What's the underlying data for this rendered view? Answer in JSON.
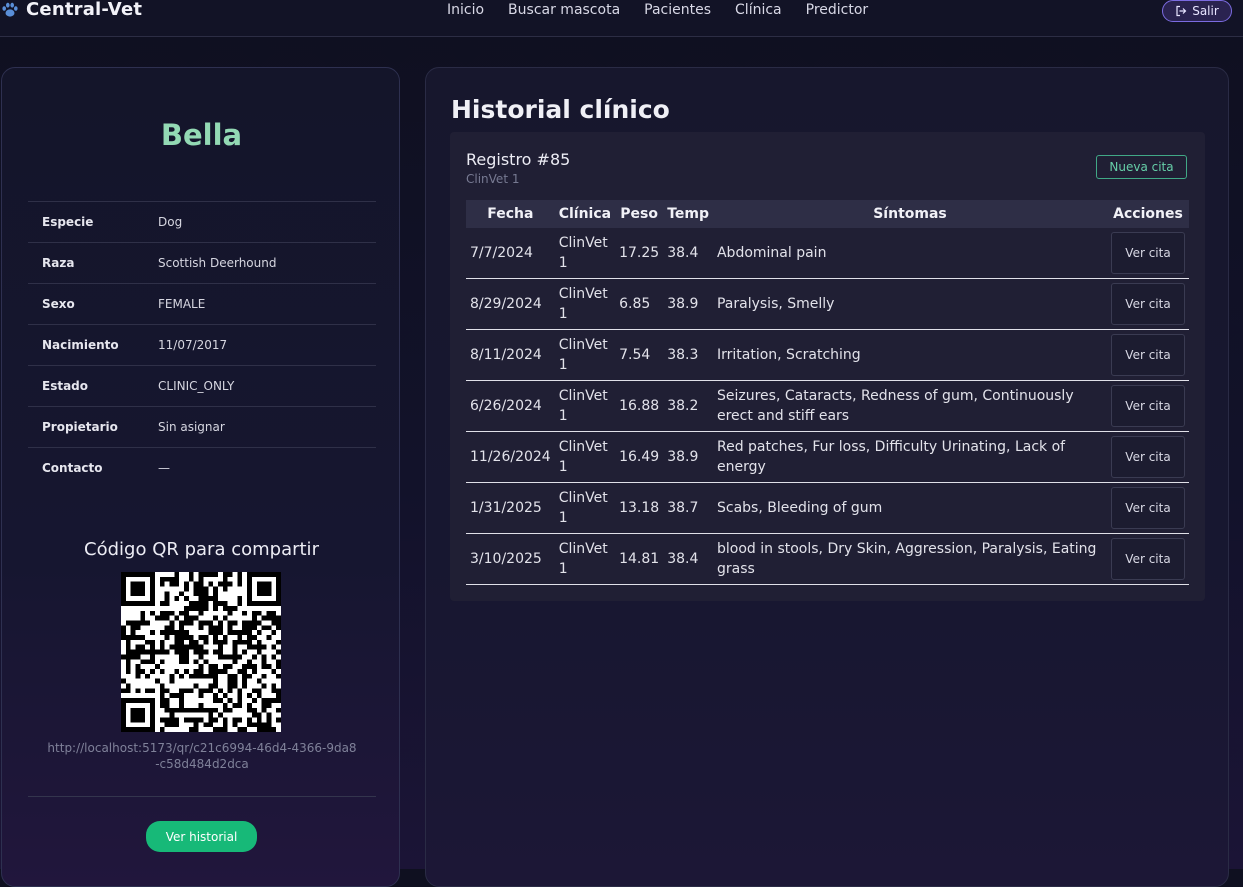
{
  "nav": {
    "brand": "Central-Vet",
    "links": [
      "Inicio",
      "Buscar mascota",
      "Pacientes",
      "Clínica",
      "Predictor"
    ],
    "logout_label": "Salir"
  },
  "pet": {
    "name": "Bella",
    "info": [
      {
        "label": "Especie",
        "value": "Dog"
      },
      {
        "label": "Raza",
        "value": "Scottish Deerhound"
      },
      {
        "label": "Sexo",
        "value": "FEMALE"
      },
      {
        "label": "Nacimiento",
        "value": "11/07/2017"
      },
      {
        "label": "Estado",
        "value": "CLINIC_ONLY"
      },
      {
        "label": "Propietario",
        "value": "Sin asignar"
      },
      {
        "label": "Contacto",
        "value": "—"
      }
    ],
    "qr_title": "Código QR para compartir",
    "qr_url": "http://localhost:5173/qr/c21c6994-46d4-4366-9da8-c58d484d2dca",
    "history_button": "Ver historial"
  },
  "history": {
    "title": "Historial clínico",
    "record_title": "Registro #85",
    "record_subtitle": "ClinVet 1",
    "new_button": "Nueva cita",
    "columns": [
      "Fecha",
      "Clínica",
      "Peso",
      "Temp",
      "Síntomas",
      "Acciones"
    ],
    "action_label": "Ver cita",
    "rows": [
      {
        "fecha": "7/7/2024",
        "clinica": "ClinVet 1",
        "peso": "17.25",
        "temp": "38.4",
        "sintomas": "Abdominal pain"
      },
      {
        "fecha": "8/29/2024",
        "clinica": "ClinVet 1",
        "peso": "6.85",
        "temp": "38.9",
        "sintomas": "Paralysis, Smelly"
      },
      {
        "fecha": "8/11/2024",
        "clinica": "ClinVet 1",
        "peso": "7.54",
        "temp": "38.3",
        "sintomas": "Irritation, Scratching"
      },
      {
        "fecha": "6/26/2024",
        "clinica": "ClinVet 1",
        "peso": "16.88",
        "temp": "38.2",
        "sintomas": "Seizures, Cataracts, Redness of gum, Continuously erect and stiff ears"
      },
      {
        "fecha": "11/26/2024",
        "clinica": "ClinVet 1",
        "peso": "16.49",
        "temp": "38.9",
        "sintomas": "Red patches, Fur loss, Difficulty Urinating, Lack of energy"
      },
      {
        "fecha": "1/31/2025",
        "clinica": "ClinVet 1",
        "peso": "13.18",
        "temp": "38.7",
        "sintomas": "Scabs, Bleeding of gum"
      },
      {
        "fecha": "3/10/2025",
        "clinica": "ClinVet 1",
        "peso": "14.81",
        "temp": "38.4",
        "sintomas": "blood in stools, Dry Skin, Aggression, Paralysis, Eating grass"
      }
    ]
  },
  "colors": {
    "accent_green": "#17b978",
    "pet_name": "#93d9b4",
    "logout_border": "#7b6be0"
  },
  "icons": {
    "brand": "paw-icon",
    "logout": "logout-icon",
    "qr": "qr-code-icon"
  }
}
